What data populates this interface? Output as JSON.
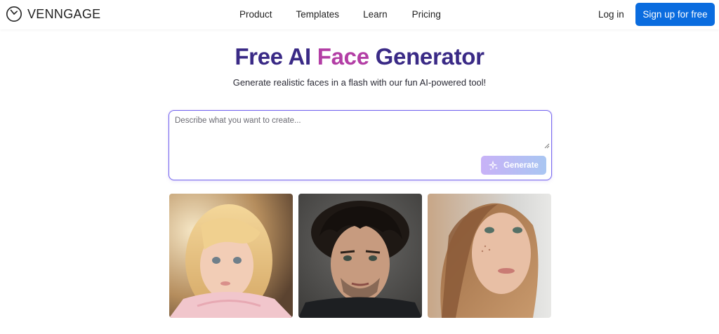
{
  "header": {
    "brand": "VENNGAGE",
    "logo_icon": "venngage-clock-logo-icon",
    "nav": [
      "Product",
      "Templates",
      "Learn",
      "Pricing"
    ],
    "login_label": "Log in",
    "signup_label": "Sign up for free"
  },
  "hero": {
    "title_part1": "Free AI ",
    "title_accent": "Face",
    "title_part2": " Generator",
    "subtitle": "Generate realistic faces in a flash with our fun AI-powered tool!"
  },
  "prompt": {
    "placeholder": "Describe what you want to create...",
    "value": "",
    "generate_label": "Generate",
    "generate_icon": "sparkle-icon"
  },
  "colors": {
    "brand_blue": "#0a6cdf",
    "title_purple": "#3a2a86",
    "accent_magenta": "#b33ea5"
  }
}
